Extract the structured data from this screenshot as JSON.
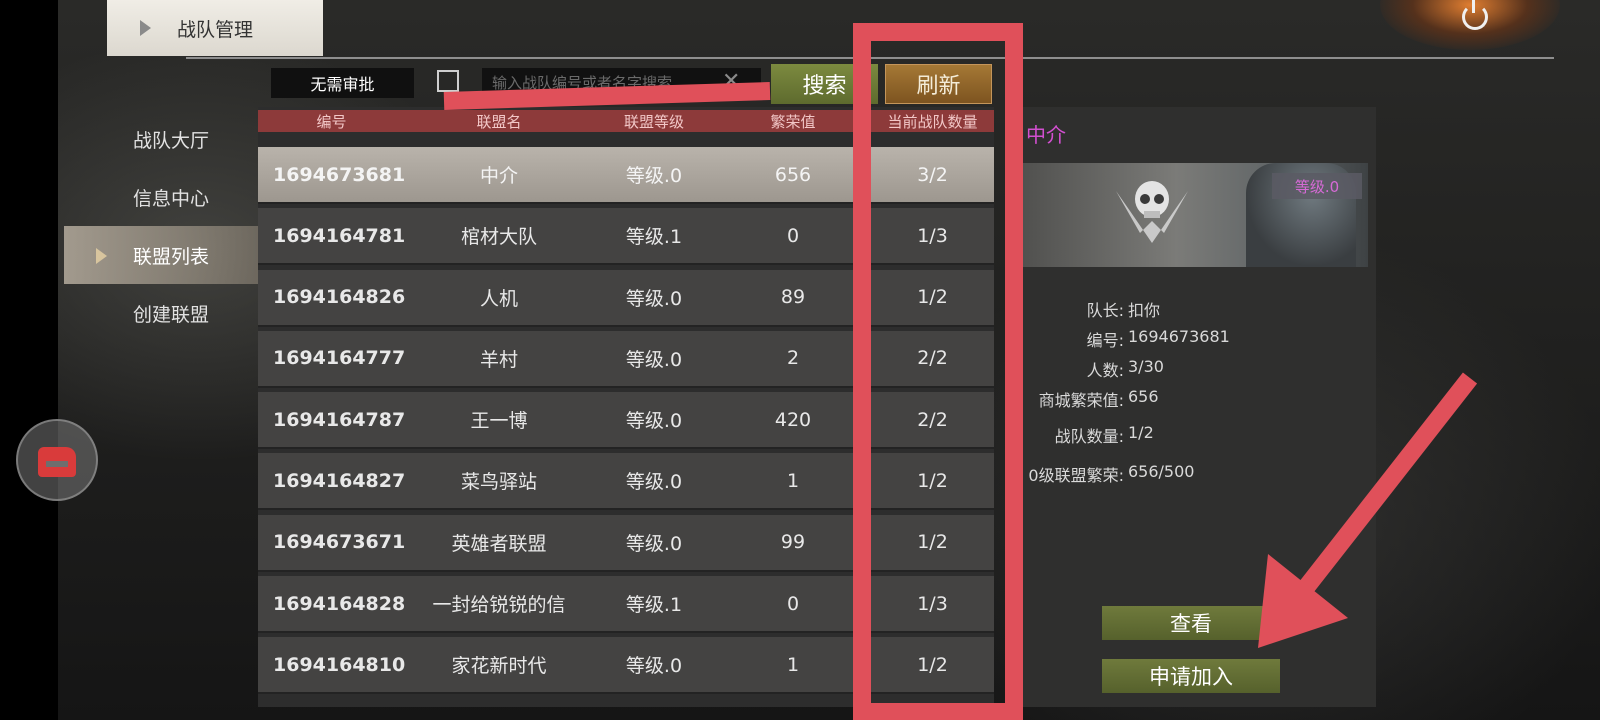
{
  "header": {
    "title": "战队管理"
  },
  "sidebar": {
    "items": [
      {
        "label": "战队大厅"
      },
      {
        "label": "信息中心"
      },
      {
        "label": "联盟列表"
      },
      {
        "label": "创建联盟"
      }
    ]
  },
  "toolbar": {
    "no_approval_label": "无需审批",
    "search_placeholder": "输入战队编号或者名字搜索",
    "search_label": "搜索",
    "refresh_label": "刷新"
  },
  "table": {
    "columns": [
      "编号",
      "联盟名",
      "联盟等级",
      "繁荣值",
      "当前战队数量"
    ],
    "rows": [
      {
        "id": "1694673681",
        "name": "中介",
        "level": "等级.0",
        "prosperity": "656",
        "teams": "3/2"
      },
      {
        "id": "1694164781",
        "name": "棺材大队",
        "level": "等级.1",
        "prosperity": "0",
        "teams": "1/3"
      },
      {
        "id": "1694164826",
        "name": "人机",
        "level": "等级.0",
        "prosperity": "89",
        "teams": "1/2"
      },
      {
        "id": "1694164777",
        "name": "羊村",
        "level": "等级.0",
        "prosperity": "2",
        "teams": "2/2"
      },
      {
        "id": "1694164787",
        "name": "王一博",
        "level": "等级.0",
        "prosperity": "420",
        "teams": "2/2"
      },
      {
        "id": "1694164827",
        "name": "菜鸟驿站",
        "level": "等级.0",
        "prosperity": "1",
        "teams": "1/2"
      },
      {
        "id": "1694673671",
        "name": "英雄者联盟",
        "level": "等级.0",
        "prosperity": "99",
        "teams": "1/2"
      },
      {
        "id": "1694164828",
        "name": "一封给锐锐的信",
        "level": "等级.1",
        "prosperity": "0",
        "teams": "1/3"
      },
      {
        "id": "1694164810",
        "name": "家花新时代",
        "level": "等级.0",
        "prosperity": "1",
        "teams": "1/2"
      }
    ]
  },
  "detail": {
    "name": "中介",
    "level_badge": "等级.0",
    "fields": [
      {
        "label": "队长:",
        "value": "扣你"
      },
      {
        "label": "编号:",
        "value": "1694673681"
      },
      {
        "label": "人数:",
        "value": "3/30"
      },
      {
        "label": "商城繁荣值:",
        "value": "656"
      },
      {
        "label": "战队数量:",
        "value": "1/2"
      },
      {
        "label": "0级联盟繁荣:",
        "value": "656/500"
      }
    ],
    "view_label": "查看",
    "join_label": "申请加入"
  },
  "colors": {
    "annotation_red": "#e0505a",
    "header_row": "#8d3a3a",
    "button_green": "#6f7a3c",
    "button_orange": "#a57835",
    "alliance_name_purple": "#d24fd0"
  },
  "icons": {
    "power": "power-icon",
    "clear": "close-icon",
    "floating": "chat-bubble-icon",
    "emblem": "skull-emblem-icon"
  }
}
